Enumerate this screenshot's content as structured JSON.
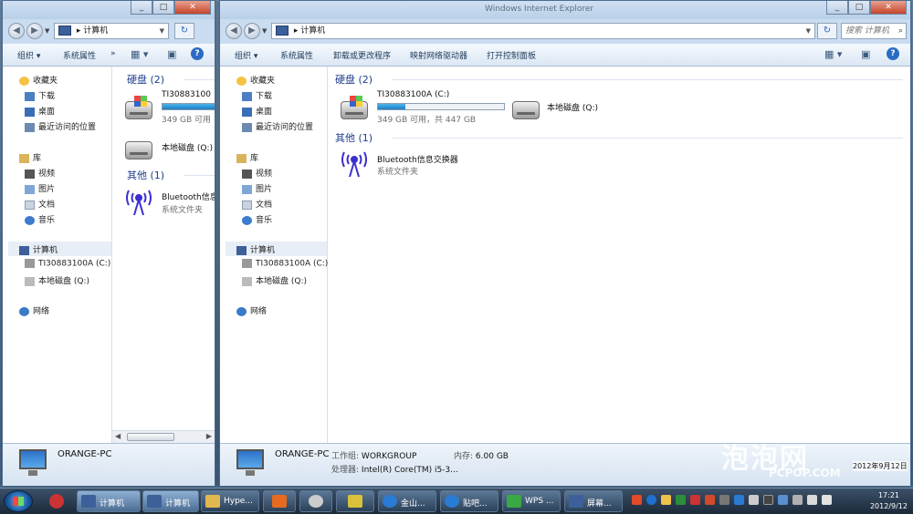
{
  "window1": {
    "address": "计算机",
    "toolbar": [
      "组织",
      "系统属性"
    ],
    "nav": {
      "favorites": "收藏夹",
      "downloads": "下载",
      "desktop": "桌面",
      "recent": "最近访问的位置",
      "libraries": "库",
      "videos": "视频",
      "pictures": "图片",
      "documents": "文档",
      "music": "音乐",
      "computer": "计算机",
      "drive_c": "TI30883100A (C:)",
      "drive_q": "本地磁盘 (Q:)",
      "network": "网络"
    },
    "hdd_group": "硬盘 (2)",
    "drive_c_name": "TI30883100",
    "drive_c_free": "349 GB 可用",
    "drive_q_name": "本地磁盘 (Q:)",
    "other_group": "其他 (1)",
    "bt_name": "Bluetooth信息",
    "bt_sub": "系统文件夹",
    "details_name": "ORANGE-PC"
  },
  "window2": {
    "title": "Windows Internet Explorer",
    "address": "计算机",
    "search_placeholder": "搜索 计算机",
    "toolbar": [
      "组织",
      "系统属性",
      "卸载或更改程序",
      "映射网络驱动器",
      "打开控制面板"
    ],
    "nav": {
      "favorites": "收藏夹",
      "downloads": "下载",
      "desktop": "桌面",
      "recent": "最近访问的位置",
      "libraries": "库",
      "videos": "视频",
      "pictures": "图片",
      "documents": "文档",
      "music": "音乐",
      "computer": "计算机",
      "drive_c": "TI30883100A (C:)",
      "drive_q": "本地磁盘 (Q:)",
      "network": "网络"
    },
    "hdd_group": "硬盘 (2)",
    "drive_c_name": "TI30883100A (C:)",
    "drive_c_free": "349 GB 可用，共 447 GB",
    "drive_c_used_fraction": 0.22,
    "drive_q_name": "本地磁盘 (Q:)",
    "other_group": "其他 (1)",
    "bt_name": "Bluetooth信息交换器",
    "bt_sub": "系统文件夹",
    "details_name": "ORANGE-PC",
    "workgroup_label": "工作组:",
    "workgroup_value": "WORKGROUP",
    "memory_label": "内存:",
    "memory_value": "6.00 GB",
    "cpu_label": "处理器:",
    "cpu_value": "Intel(R) Core(TM) i5-3..."
  },
  "taskbar": {
    "buttons": [
      {
        "label": "计算机"
      },
      {
        "label": "计算机"
      },
      {
        "label": "Hype..."
      },
      {
        "label": ""
      },
      {
        "label": ""
      },
      {
        "label": ""
      },
      {
        "label": "金山..."
      },
      {
        "label": "贴吧..."
      },
      {
        "label": "WPS ..."
      },
      {
        "label": "屏幕..."
      }
    ],
    "time": "17:21",
    "date": "2012/9/12"
  },
  "watermark": {
    "logo": "泡泡网",
    "url": "PCPOP.COM",
    "date_overlay": "2012年9月12日"
  },
  "colors": {
    "accent": "#1e3d8f",
    "bar_fill": "#1e7fc6",
    "taskbar": "#1c2a3a"
  }
}
